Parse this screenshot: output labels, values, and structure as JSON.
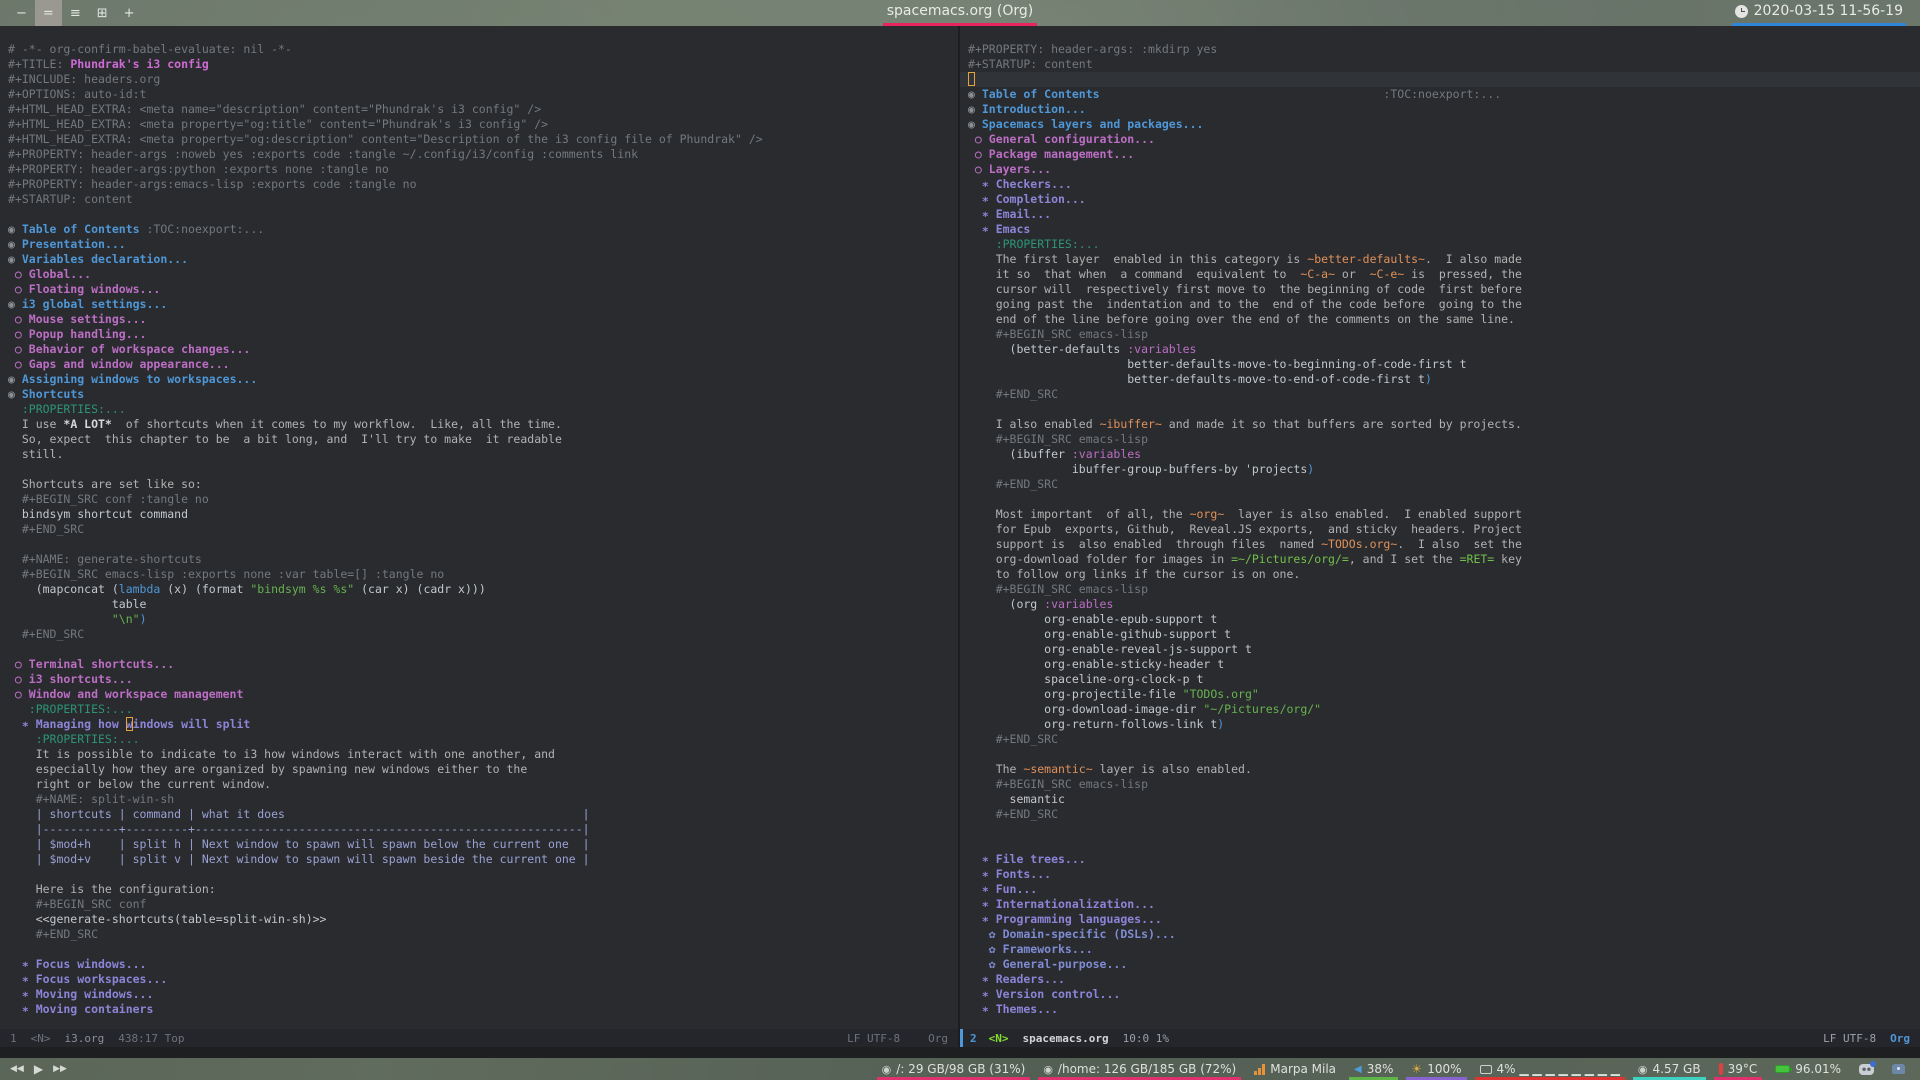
{
  "topbar": {
    "workspaces": {
      "items": [
        "−",
        "=",
        "≡",
        "⊞",
        "+"
      ],
      "active": 1
    },
    "title": "spacemacs.org (Org)",
    "clock": "2020-03-15 11-56-19"
  },
  "colors": {
    "editor_bg": "#292b2e",
    "head1": "#4f97d7",
    "head2": "#bc6ec5",
    "head3": "#8d84d8",
    "cursor": "#e6a23c",
    "title_underline": "#e8255f",
    "clock_underline": "#2e86d9"
  },
  "panes": {
    "left": {
      "lines": [
        [
          [
            "cm",
            "# -*- org-confirm-babel-evaluate: nil -*-"
          ]
        ],
        [
          [
            "cm",
            "#+TITLE: "
          ],
          [
            "ttl",
            "Phundrak's i3 config"
          ]
        ],
        [
          [
            "cm",
            "#+INCLUDE: headers.org"
          ]
        ],
        [
          [
            "cm",
            "#+OPTIONS: auto-id:t"
          ]
        ],
        [
          [
            "cm",
            "#+HTML_HEAD_EXTRA: <meta name=\"description\" content=\"Phundrak's i3 config\" />"
          ]
        ],
        [
          [
            "cm",
            "#+HTML_HEAD_EXTRA: <meta property=\"og:title\" content=\"Phundrak's i3 config\" />"
          ]
        ],
        [
          [
            "cm",
            "#+HTML_HEAD_EXTRA: <meta property=\"og:description\" content=\"Description of the i3 config file of Phundrak\" />"
          ]
        ],
        [
          [
            "cm",
            "#+PROPERTY: header-args :noweb yes :exports code :tangle ~/.config/i3/config :comments link"
          ]
        ],
        [
          [
            "cm",
            "#+PROPERTY: header-args:python :exports none :tangle no"
          ]
        ],
        [
          [
            "cm",
            "#+PROPERTY: header-args:emacs-lisp :exports code :tangle no"
          ]
        ],
        [
          [
            "cm",
            "#+STARTUP: content"
          ]
        ],
        [],
        [
          [
            "b1",
            "◉ "
          ],
          [
            "t1",
            "Table of Contents"
          ],
          [
            "tag",
            " :TOC:noexport:..."
          ]
        ],
        [
          [
            "b1",
            "◉ "
          ],
          [
            "t1",
            "Presentation..."
          ]
        ],
        [
          [
            "b1",
            "◉ "
          ],
          [
            "t1",
            "Variables declaration..."
          ]
        ],
        [
          [
            "t2",
            " ○ Global..."
          ]
        ],
        [
          [
            "t2",
            " ○ Floating windows..."
          ]
        ],
        [
          [
            "b1",
            "◉ "
          ],
          [
            "t1",
            "i3 global settings..."
          ]
        ],
        [
          [
            "t2",
            " ○ Mouse settings..."
          ]
        ],
        [
          [
            "t2",
            " ○ Popup handling..."
          ]
        ],
        [
          [
            "t2",
            " ○ Behavior of workspace changes..."
          ]
        ],
        [
          [
            "t2",
            " ○ Gaps and window appearance..."
          ]
        ],
        [
          [
            "b1",
            "◉ "
          ],
          [
            "t1",
            "Assigning windows to workspaces..."
          ]
        ],
        [
          [
            "b1",
            "◉ "
          ],
          [
            "t1",
            "Shortcuts"
          ]
        ],
        [
          [
            "prop",
            "  :PROPERTIES:..."
          ]
        ],
        [
          [
            "txt",
            "  I use "
          ],
          [
            "b",
            "*A LOT*"
          ],
          [
            "txt",
            "  of shortcuts when it comes to my workflow.  Like, all the time."
          ]
        ],
        [
          [
            "txt",
            "  So, expect  this chapter to be  a bit long, and  I'll try to make  it readable"
          ]
        ],
        [
          [
            "txt",
            "  still."
          ]
        ],
        [],
        [
          [
            "txt",
            "  Shortcuts are set like so:"
          ]
        ],
        [
          [
            "cm",
            "  #+BEGIN_SRC conf :tangle no"
          ]
        ],
        [
          [
            "wh",
            "  bindsym shortcut command"
          ]
        ],
        [
          [
            "cm",
            "  #+END_SRC"
          ]
        ],
        [],
        [
          [
            "cm",
            "  #+NAME: generate-shortcuts"
          ]
        ],
        [
          [
            "cm",
            "  #+BEGIN_SRC emacs-lisp :exports none :var table=[] :tangle no"
          ]
        ],
        [
          [
            "wh",
            "    (mapconcat ("
          ],
          [
            "kwb",
            "lambda"
          ],
          [
            "wh",
            " (x) (format "
          ],
          [
            "str",
            "\"bindsym %s %s\""
          ],
          [
            "wh",
            " (car x) (cadr x)))"
          ]
        ],
        [
          [
            "wh",
            "               table"
          ]
        ],
        [
          [
            "str",
            "               \"\\n\""
          ],
          [
            "kwb",
            ")"
          ]
        ],
        [
          [
            "cm",
            "  #+END_SRC"
          ]
        ],
        [],
        [
          [
            "t2",
            " ○ Terminal shortcuts..."
          ]
        ],
        [
          [
            "t2",
            " ○ i3 shortcuts..."
          ]
        ],
        [
          [
            "t2",
            " ○ Window and workspace management"
          ]
        ],
        [
          [
            "prop",
            "   :PROPERTIES:..."
          ]
        ],
        [
          [
            "t3",
            "  ∗ Managing how "
          ],
          [
            "t3 cur",
            "w"
          ],
          [
            "t3",
            "indows will split"
          ]
        ],
        [
          [
            "prop",
            "    :PROPERTIES:..."
          ]
        ],
        [
          [
            "txt",
            "    It is possible to indicate to i3 how windows interact with one another, and"
          ]
        ],
        [
          [
            "txt",
            "    especially how they are organized by spawning new windows either to the"
          ]
        ],
        [
          [
            "txt",
            "    right or below the current window."
          ]
        ],
        [
          [
            "cm",
            "    #+NAME: split-win-sh"
          ]
        ],
        [
          [
            "tbl",
            "    | shortcuts | command | what it does                                           |"
          ]
        ],
        [
          [
            "tbl",
            "    |-----------+---------+--------------------------------------------------------|"
          ]
        ],
        [
          [
            "tbl",
            "    | $mod+h    | split h | Next window to spawn will spawn below the current one  |"
          ]
        ],
        [
          [
            "tbl",
            "    | $mod+v    | split v | Next window to spawn will spawn beside the current one |"
          ]
        ],
        [],
        [
          [
            "txt",
            "    Here is the configuration:"
          ]
        ],
        [
          [
            "cm",
            "    #+BEGIN_SRC conf"
          ]
        ],
        [
          [
            "wh",
            "    <<generate-shortcuts(table=split-win-sh)>>"
          ]
        ],
        [
          [
            "cm",
            "    #+END_SRC"
          ]
        ],
        [],
        [
          [
            "t3",
            "  ∗ Focus windows..."
          ]
        ],
        [
          [
            "t3",
            "  ∗ Focus workspaces..."
          ]
        ],
        [
          [
            "t3",
            "  ∗ Moving windows..."
          ]
        ],
        [
          [
            "t3",
            "  ∗ Moving containers"
          ]
        ]
      ],
      "hl_lines": []
    },
    "right": {
      "lines": [
        [
          [
            "cm",
            "#+PROPERTY: header-args: :mkdirp yes"
          ]
        ],
        [
          [
            "cm",
            "#+STARTUP: content"
          ]
        ],
        [
          [
            "cur",
            " "
          ]
        ],
        [
          [
            "b1",
            "◉ "
          ],
          [
            "t1",
            "Table of Contents"
          ],
          [
            "tag",
            "                                         :TOC:noexport:..."
          ]
        ],
        [
          [
            "b1",
            "◉ "
          ],
          [
            "t1",
            "Introduction..."
          ]
        ],
        [
          [
            "b1",
            "◉ "
          ],
          [
            "t1",
            "Spacemacs layers and packages..."
          ]
        ],
        [
          [
            "t2",
            " ○ General configuration..."
          ]
        ],
        [
          [
            "t2",
            " ○ Package management..."
          ]
        ],
        [
          [
            "t2",
            " ○ Layers..."
          ]
        ],
        [
          [
            "t3",
            "  ∗ Checkers..."
          ]
        ],
        [
          [
            "t3",
            "  ∗ Completion..."
          ]
        ],
        [
          [
            "t3",
            "  ∗ Email..."
          ]
        ],
        [
          [
            "t3",
            "  ∗ Emacs"
          ]
        ],
        [
          [
            "prop",
            "    :PROPERTIES:..."
          ]
        ],
        [
          [
            "txt",
            "    The first layer  enabled in this category is "
          ],
          [
            "code",
            "~better-defaults~"
          ],
          [
            "txt",
            ".  I also made"
          ]
        ],
        [
          [
            "txt",
            "    it so  that when  a command  equivalent to  "
          ],
          [
            "code",
            "~C-a~"
          ],
          [
            "txt",
            " or  "
          ],
          [
            "code",
            "~C-e~"
          ],
          [
            "txt",
            " is  pressed, the"
          ]
        ],
        [
          [
            "txt",
            "    cursor will  respectively first move to  the beginning of code  first before"
          ]
        ],
        [
          [
            "txt",
            "    going past the  indentation and to the  end of the code before  going to the"
          ]
        ],
        [
          [
            "txt",
            "    end of the line before going over the end of the comments on the same line."
          ]
        ],
        [
          [
            "cm",
            "    #+BEGIN_SRC emacs-lisp"
          ]
        ],
        [
          [
            "wh",
            "      (better-defaults "
          ],
          [
            "kwm",
            ":variables"
          ]
        ],
        [
          [
            "wh",
            "                       better-defaults-move-to-beginning-of-code-first t"
          ]
        ],
        [
          [
            "wh",
            "                       better-defaults-move-to-end-of-code-first t"
          ],
          [
            "kwb",
            ")"
          ]
        ],
        [
          [
            "cm",
            "    #+END_SRC"
          ]
        ],
        [],
        [
          [
            "txt",
            "    I also enabled "
          ],
          [
            "code",
            "~ibuffer~"
          ],
          [
            "txt",
            " and made it so that buffers are sorted by projects."
          ]
        ],
        [
          [
            "cm",
            "    #+BEGIN_SRC emacs-lisp"
          ]
        ],
        [
          [
            "wh",
            "      (ibuffer "
          ],
          [
            "kwm",
            ":variables"
          ]
        ],
        [
          [
            "wh",
            "               ibuffer-group-buffers-by 'projects"
          ],
          [
            "kwb",
            ")"
          ]
        ],
        [
          [
            "cm",
            "    #+END_SRC"
          ]
        ],
        [],
        [
          [
            "txt",
            "    Most important  of all, the "
          ],
          [
            "code",
            "~org~"
          ],
          [
            "txt",
            "  layer is also enabled.  I enabled support"
          ]
        ],
        [
          [
            "txt",
            "    for Epub  exports, Github,  Reveal.JS exports,  and sticky  headers. Project"
          ]
        ],
        [
          [
            "txt",
            "    support is  also enabled  through files  named "
          ],
          [
            "code",
            "~TODOs.org~"
          ],
          [
            "txt",
            ".  I also  set the"
          ]
        ],
        [
          [
            "txt",
            "    org-download folder for images in "
          ],
          [
            "verb",
            "=~/Pictures/org/="
          ],
          [
            "txt",
            ", and I set the "
          ],
          [
            "verb",
            "=RET="
          ],
          [
            "txt",
            " key"
          ]
        ],
        [
          [
            "txt",
            "    to follow org links if the cursor is on one."
          ]
        ],
        [
          [
            "cm",
            "    #+BEGIN_SRC emacs-lisp"
          ]
        ],
        [
          [
            "wh",
            "      (org "
          ],
          [
            "kwm",
            ":variables"
          ]
        ],
        [
          [
            "wh",
            "           org-enable-epub-support t"
          ]
        ],
        [
          [
            "wh",
            "           org-enable-github-support t"
          ]
        ],
        [
          [
            "wh",
            "           org-enable-reveal-js-support t"
          ]
        ],
        [
          [
            "wh",
            "           org-enable-sticky-header t"
          ]
        ],
        [
          [
            "wh",
            "           spaceline-org-clock-p t"
          ]
        ],
        [
          [
            "wh",
            "           org-projectile-file "
          ],
          [
            "str",
            "\"TODOs.org\""
          ]
        ],
        [
          [
            "wh",
            "           org-download-image-dir "
          ],
          [
            "str",
            "\"~/Pictures/org/\""
          ]
        ],
        [
          [
            "wh",
            "           org-return-follows-link t"
          ],
          [
            "kwb",
            ")"
          ]
        ],
        [
          [
            "cm",
            "    #+END_SRC"
          ]
        ],
        [],
        [
          [
            "txt",
            "    The "
          ],
          [
            "code",
            "~semantic~"
          ],
          [
            "txt",
            " layer is also enabled."
          ]
        ],
        [
          [
            "cm",
            "    #+BEGIN_SRC emacs-lisp"
          ]
        ],
        [
          [
            "wh",
            "      semantic"
          ]
        ],
        [
          [
            "cm",
            "    #+END_SRC"
          ]
        ],
        [],
        [],
        [
          [
            "t3",
            "  ∗ File trees..."
          ]
        ],
        [
          [
            "t3",
            "  ∗ Fonts..."
          ]
        ],
        [
          [
            "t3",
            "  ∗ Fun..."
          ]
        ],
        [
          [
            "t3",
            "  ∗ Internationalization..."
          ]
        ],
        [
          [
            "t3",
            "  ∗ Programming languages..."
          ]
        ],
        [
          [
            "t4",
            "   ✿ Domain-specific (DSLs)..."
          ]
        ],
        [
          [
            "t4",
            "   ✿ Frameworks..."
          ]
        ],
        [
          [
            "t4",
            "   ✿ General-purpose..."
          ]
        ],
        [
          [
            "t3",
            "  ∗ Readers..."
          ]
        ],
        [
          [
            "t3",
            "  ∗ Version control..."
          ]
        ],
        [
          [
            "t3",
            "  ∗ Themes..."
          ]
        ]
      ],
      "hl_lines": [
        2
      ]
    }
  },
  "modelines": {
    "left": {
      "win": "1",
      "state": "<N>",
      "buffer": "i3.org",
      "position": "438:17 Top",
      "eol": "LF UTF-8",
      "mode": "Org"
    },
    "right": {
      "win": "2",
      "state": "<N>",
      "buffer": "spacemacs.org",
      "position": "10:0  1%",
      "eol": "LF UTF-8",
      "mode": "Org"
    }
  },
  "polybar": {
    "media": {
      "prev": "◀◀",
      "play": "▶",
      "next": "▶▶"
    },
    "stats": [
      {
        "icon": "disk",
        "label": "/: 29 GB/98 GB (31%)",
        "underline": "#e0316e"
      },
      {
        "icon": "disk",
        "label": "/home: 126 GB/185 GB (72%)",
        "underline": "#e0316e"
      },
      {
        "icon": "wifi",
        "label": "Marpa Mila",
        "underline": ""
      },
      {
        "icon": "volume",
        "label": "38%",
        "underline": "#5fb548"
      },
      {
        "icon": "sun",
        "label": "100%",
        "underline": "#8a63d2"
      },
      {
        "icon": "cpu",
        "label": "4% ▁ ▁ ▁ ▁ ▁ ▁ ▁ ▁",
        "underline": "#e03434"
      },
      {
        "icon": "ram",
        "label": "4.57 GB",
        "underline": "#3fd2c2"
      },
      {
        "icon": "temp",
        "label": "39°C",
        "underline": "#e0316e"
      },
      {
        "icon": "battery",
        "label": "96.01%",
        "underline": ""
      },
      {
        "icon": "discord",
        "label": "",
        "underline": ""
      },
      {
        "icon": "tray",
        "label": "",
        "underline": ""
      }
    ]
  }
}
